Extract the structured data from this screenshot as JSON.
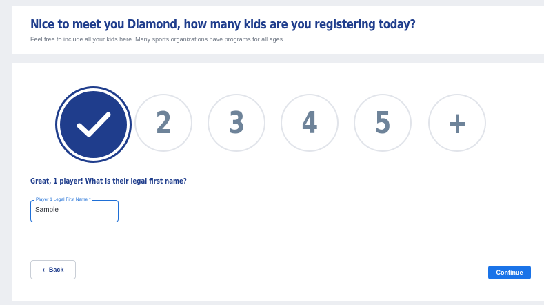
{
  "header": {
    "title": "Nice to meet you Diamond, how many kids are you registering today?",
    "subtitle": "Feel free to include all your kids here. Many sports organizations have programs for all ages."
  },
  "kid_count": {
    "options": [
      "2",
      "3",
      "4",
      "5",
      "+"
    ],
    "selected_icon": "check-icon"
  },
  "name_prompt": "Great, 1 player! What is their legal first name?",
  "name_field": {
    "label": "Player 1 Legal First Name *",
    "value": "Sample"
  },
  "nav": {
    "back_label": "Back",
    "back_icon": "‹",
    "continue_label": "Continue"
  },
  "colors": {
    "brand": "#1f3d8c",
    "accent": "#1a73e8",
    "muted_digit": "#6e8399"
  }
}
